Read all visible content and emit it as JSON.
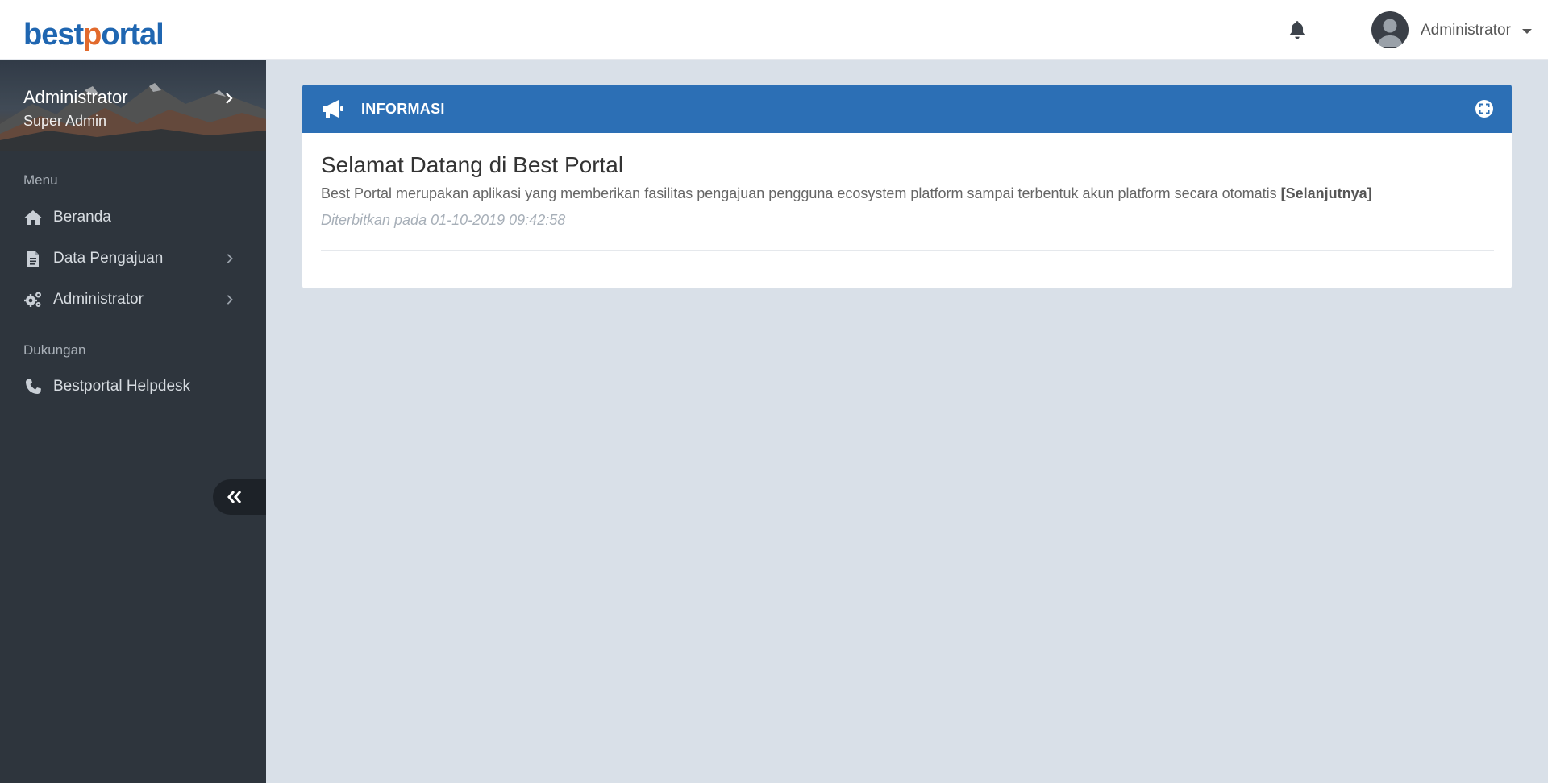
{
  "app": {
    "logo": {
      "part1": "best",
      "part2": "p",
      "part3": "ortal"
    },
    "colors": {
      "brand_blue": "#1f66b1",
      "brand_orange": "#e26a2c",
      "sidebar_bg": "#2e353d",
      "panel_header": "#2c6fb5",
      "content_bg": "#d9e0e8"
    }
  },
  "header": {
    "notification_icon": "bell-icon",
    "user": {
      "name": "Administrator",
      "avatar_icon": "user-avatar-icon"
    }
  },
  "sidebar": {
    "profile": {
      "name": "Administrator",
      "role": "Super Admin"
    },
    "sections": [
      {
        "label": "Menu",
        "items": [
          {
            "label": "Beranda",
            "icon": "home-icon",
            "has_submenu": false
          },
          {
            "label": "Data Pengajuan",
            "icon": "document-icon",
            "has_submenu": true
          },
          {
            "label": "Administrator",
            "icon": "gears-icon",
            "has_submenu": true
          }
        ]
      },
      {
        "label": "Dukungan",
        "items": [
          {
            "label": "Bestportal Helpdesk",
            "icon": "phone-icon",
            "has_submenu": false
          }
        ]
      }
    ],
    "collapse_icon": "double-chevron-left-icon"
  },
  "main": {
    "panel": {
      "title": "INFORMASI",
      "icon": "megaphone-icon",
      "expand_icon": "expand-icon",
      "post": {
        "title": "Selamat Datang di Best Portal",
        "body": "Best Portal merupakan aplikasi yang memberikan fasilitas pengajuan pengguna ecosystem platform sampai terbentuk akun platform secara otomatis ",
        "read_more": "[Selanjutnya]",
        "published": "Diterbitkan pada 01-10-2019 09:42:58"
      }
    }
  }
}
